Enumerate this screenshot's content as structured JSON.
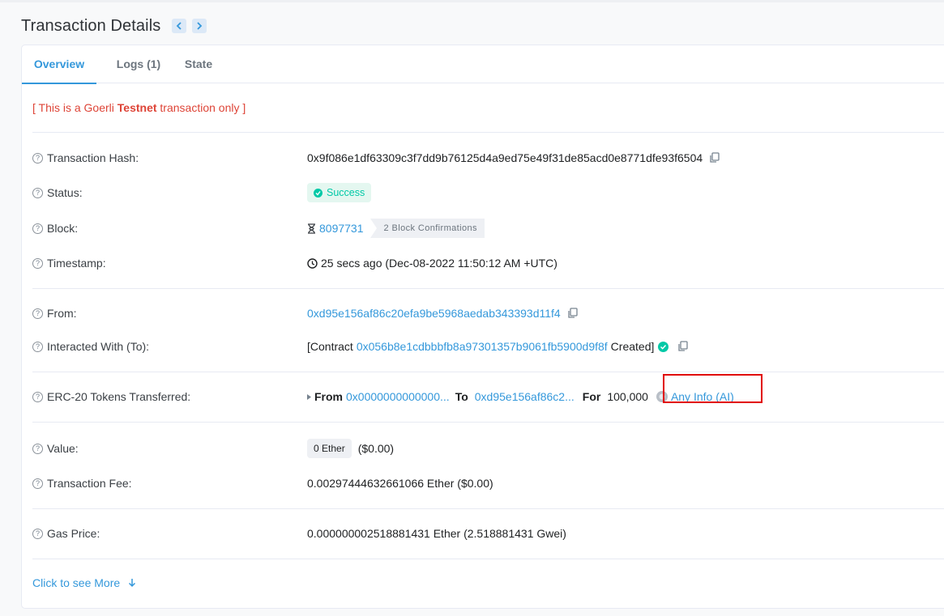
{
  "header": {
    "title": "Transaction Details"
  },
  "tabs": [
    {
      "label": "Overview",
      "active": true
    },
    {
      "label": "Logs (1)",
      "active": false
    },
    {
      "label": "State",
      "active": false
    }
  ],
  "notice": {
    "prefix": "[ This is a Goerli ",
    "bold": "Testnet",
    "suffix": " transaction only ]"
  },
  "rows": {
    "tx_hash": {
      "label": "Transaction Hash:",
      "value": "0x9f086e1df63309c3f7dd9b76125d4a9ed75e49f31de85acd0e8771dfe93f6504"
    },
    "status": {
      "label": "Status:",
      "value": "Success"
    },
    "block": {
      "label": "Block:",
      "number": "8097731",
      "confirmations": "2 Block Confirmations"
    },
    "timestamp": {
      "label": "Timestamp:",
      "value": "25 secs ago (Dec-08-2022 11:50:12 AM +UTC)"
    },
    "from": {
      "label": "From:",
      "value": "0xd95e156af86c20efa9be5968aedab343393d11f4"
    },
    "to": {
      "label": "Interacted With (To):",
      "prefix": "[Contract ",
      "address": "0x056b8e1cdbbbfb8a97301357b9061fb5900d9f8f",
      "suffix": " Created]"
    },
    "erc20": {
      "label": "ERC-20 Tokens Transferred:",
      "from_label": "From",
      "from_value": "0x0000000000000...",
      "to_label": "To",
      "to_value": "0xd95e156af86c2...",
      "for_label": "For",
      "amount": "100,000",
      "token": "Any Info (AI)"
    },
    "value": {
      "label": "Value:",
      "ether": "0 Ether",
      "usd": "($0.00)"
    },
    "fee": {
      "label": "Transaction Fee:",
      "value": "0.00297444632661066 Ether ($0.00)"
    },
    "gas": {
      "label": "Gas Price:",
      "value": "0.000000002518881431 Ether (2.518881431 Gwei)"
    }
  },
  "more": {
    "label": "Click to see More"
  },
  "colors": {
    "accent": "#3498db",
    "success": "#00c9a7",
    "danger": "#de4437",
    "highlight": "#e10000"
  }
}
